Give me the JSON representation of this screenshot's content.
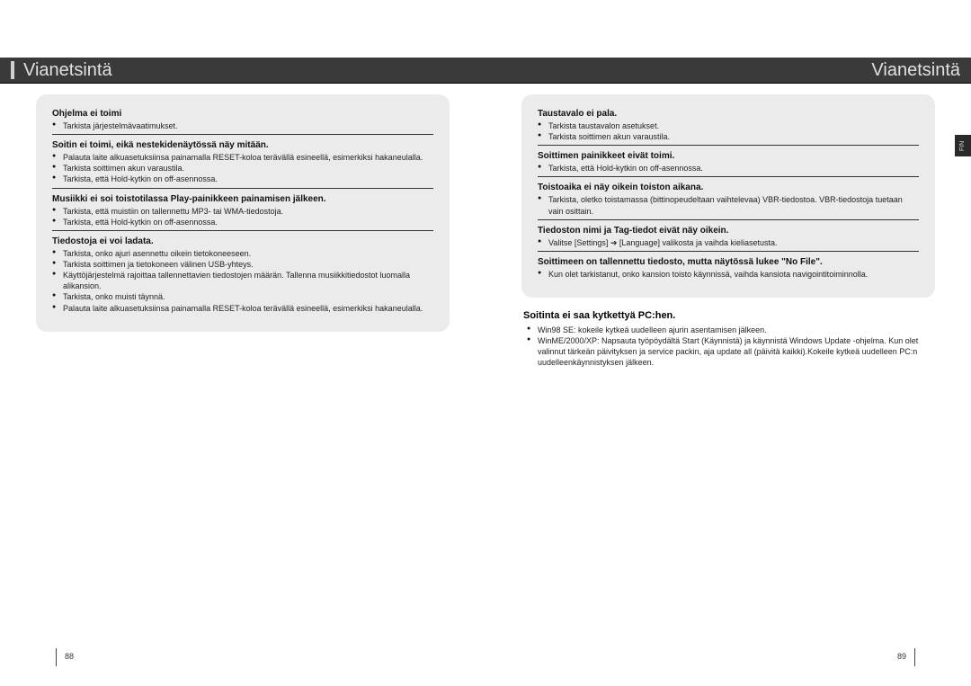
{
  "left": {
    "title": "Vianetsintä",
    "page_number": "88",
    "sections": [
      {
        "heading": "Ohjelma ei toimi",
        "bullets": [
          "Tarkista järjestelmävaatimukset."
        ]
      },
      {
        "heading": "Soitin ei toimi, eikä nestekidenäytössä näy mitään.",
        "bullets": [
          "Palauta laite alkuasetuksiinsa painamalla RESET-koloa terävällä esineellä, esimerkiksi hakaneulalla.",
          "Tarkista soittimen akun varaustila.",
          "Tarkista, että Hold-kytkin on off-asennossa."
        ]
      },
      {
        "heading": "Musiikki ei soi toistotilassa Play-painikkeen painamisen jälkeen.",
        "bullets": [
          "Tarkista, että muistiin on tallennettu MP3- tai WMA-tiedostoja.",
          "Tarkista, että Hold-kytkin on off-asennossa."
        ]
      },
      {
        "heading": "Tiedostoja ei voi ladata.",
        "bullets": [
          "Tarkista, onko ajuri asennettu oikein tietokoneeseen.",
          "Tarkista soittimen ja tietokoneen välinen USB-yhteys.",
          "Käyttöjärjestelmä rajoittaa tallennettavien tiedostojen määrän. Tallenna musiikkitiedostot luomalla alikansion.",
          "Tarkista, onko muisti täynnä.",
          "Palauta laite alkuasetuksiinsa painamalla RESET-koloa terävällä esineellä, esimerkiksi hakaneulalla."
        ]
      }
    ]
  },
  "right": {
    "title": "Vianetsintä",
    "page_number": "89",
    "lang_tab": "FIN",
    "sections": [
      {
        "heading": "Taustavalo ei pala.",
        "bullets": [
          "Tarkista taustavalon asetukset.",
          "Tarkista soittimen akun varaustila."
        ]
      },
      {
        "heading": "Soittimen painikkeet eivät toimi.",
        "bullets": [
          "Tarkista, että Hold-kytkin on off-asennossa."
        ]
      },
      {
        "heading": "Toistoaika ei näy oikein toiston aikana.",
        "bullets": [
          "Tarkista, oletko toistamassa (bittinopeudeltaan vaihtelevaa) VBR-tiedostoa. VBR-tiedostoja tuetaan vain osittain."
        ]
      },
      {
        "heading": "Tiedoston nimi ja Tag-tiedot eivät näy oikein.",
        "bullets": [
          "Valitse [Settings] ➔ [Language] valikosta ja vaihda kieliasetusta."
        ]
      },
      {
        "heading": "Soittimeen on tallennettu tiedosto, mutta näytössä lukee \"No File\".",
        "bullets": [
          "Kun olet tarkistanut, onko kansion toisto käynnissä, vaihda kansiota navigointitoiminnolla."
        ]
      }
    ],
    "subtitle": "Soitinta ei saa kytkettyä PC:hen.",
    "sub_bullets": [
      "Win98 SE: kokeile kytkeä uudelleen ajurin asentamisen jälkeen.",
      "WinME/2000/XP: Napsauta työpöydältä Start (Käynnistä) ja käynnistä Windows Update -ohjelma. Kun olet valinnut tärkeän päivityksen ja service packin, aja update all (päivitä kaikki).Kokeile kytkeä uudelleen PC:n uudelleenkäynnistyksen jälkeen."
    ]
  }
}
